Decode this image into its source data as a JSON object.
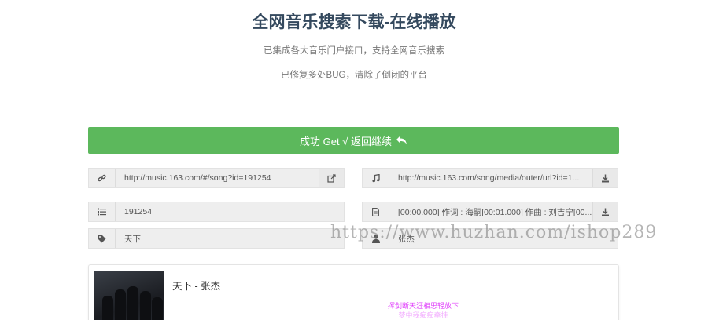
{
  "header": {
    "title": "全网音乐搜索下载-在线播放",
    "subtitle1": "已集成各大音乐门户接口，支持全网音乐搜索",
    "subtitle2": "已修复多处BUG，清除了倒闭的平台"
  },
  "success_button": {
    "label": "成功 Get √ 返回继续",
    "color": "#5cb85c"
  },
  "fields": {
    "song_url": {
      "icon": "link-icon",
      "value": "http://music.163.com/#/song?id=191254",
      "action_icon": "external-link-icon"
    },
    "media_url": {
      "icon": "music-note-icon",
      "value": "http://music.163.com/song/media/outer/url?id=1...",
      "action_icon": "download-icon"
    },
    "song_id": {
      "icon": "list-icon",
      "value": "191254"
    },
    "lyrics": {
      "icon": "document-icon",
      "value": "[00:00.000] 作词 : 海嗣[00:01.000] 作曲 : 刘吉宁[00...",
      "action_icon": "download-icon"
    },
    "song_name": {
      "icon": "tag-icon",
      "value": "天下"
    },
    "artist": {
      "icon": "user-icon",
      "value": "张杰"
    }
  },
  "player": {
    "song_title": "天下 - 张杰",
    "lyric_current": "挥剑断天涯相思轻放下",
    "lyric_next": "梦中我痴痴牵挂"
  },
  "watermark": "https://www.huzhan.com/ishop289"
}
